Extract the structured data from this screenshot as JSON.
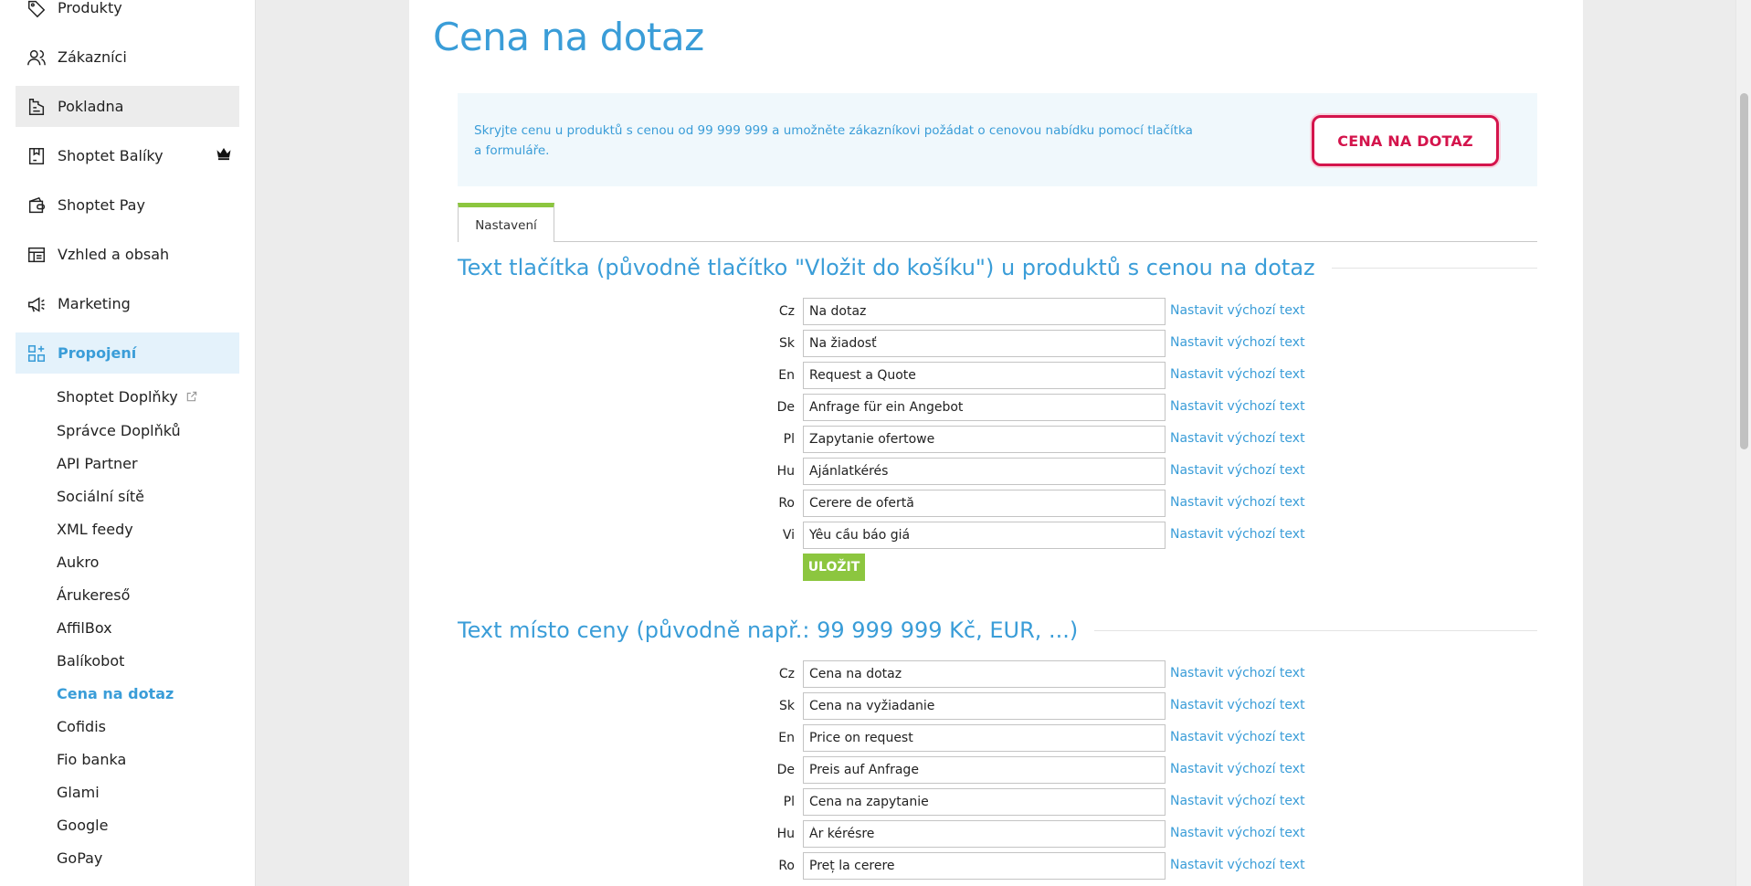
{
  "sidebar": {
    "nav": [
      {
        "label": "Produkty",
        "icon": "tag-icon"
      },
      {
        "label": "Zákazníci",
        "icon": "users-icon"
      },
      {
        "label": "Pokladna",
        "icon": "cash-register-icon"
      },
      {
        "label": "Shoptet Balíky",
        "icon": "package-icon"
      },
      {
        "label": "Shoptet Pay",
        "icon": "wallet-icon"
      },
      {
        "label": "Vzhled a obsah",
        "icon": "layout-icon"
      },
      {
        "label": "Marketing",
        "icon": "megaphone-icon"
      },
      {
        "label": "Propojení",
        "icon": "grid-plus-icon"
      }
    ],
    "sub_items": [
      {
        "label": "Shoptet Doplňky",
        "external": true
      },
      {
        "label": "Správce Doplňků"
      },
      {
        "label": "API Partner"
      },
      {
        "label": "Sociální sítě"
      },
      {
        "label": "XML feedy"
      },
      {
        "label": "Aukro"
      },
      {
        "label": "Árukereső"
      },
      {
        "label": "AffilBox"
      },
      {
        "label": "Balíkobot"
      },
      {
        "label": "Cena na dotaz",
        "active": true
      },
      {
        "label": "Cofidis"
      },
      {
        "label": "Fio banka"
      },
      {
        "label": "Glami"
      },
      {
        "label": "Google"
      },
      {
        "label": "GoPay"
      }
    ]
  },
  "page": {
    "title": "Cena na dotaz",
    "info_text": "Skryjte cenu u produktů s cenou od 99 999 999 a umožněte zákazníkovi požádat o cenovou nabídku pomocí tlačítka a formuláře.",
    "promo_button": "CENA NA DOTAZ",
    "tab": "Nastavení",
    "save_label": "ULOŽIT",
    "reset_label": "Nastavit výchozí text",
    "section1": {
      "heading": "Text tlačítka (původně tlačítko \"Vložit do košíku\") u produktů s cenou na dotaz",
      "rows": [
        {
          "lang": "Cz",
          "value": "Na dotaz"
        },
        {
          "lang": "Sk",
          "value": "Na žiadosť"
        },
        {
          "lang": "En",
          "value": "Request a Quote"
        },
        {
          "lang": "De",
          "value": "Anfrage für ein Angebot"
        },
        {
          "lang": "Pl",
          "value": "Zapytanie ofertowe"
        },
        {
          "lang": "Hu",
          "value": "Ajánlatkérés"
        },
        {
          "lang": "Ro",
          "value": "Cerere de ofertă"
        },
        {
          "lang": "Vi",
          "value": "Yêu cầu báo giá"
        }
      ]
    },
    "section2": {
      "heading": "Text místo ceny (původně např.: 99 999 999 Kč, EUR, ...)",
      "rows": [
        {
          "lang": "Cz",
          "value": "Cena na dotaz"
        },
        {
          "lang": "Sk",
          "value": "Cena na vyžiadanie"
        },
        {
          "lang": "En",
          "value": "Price on request"
        },
        {
          "lang": "De",
          "value": "Preis auf Anfrage"
        },
        {
          "lang": "Pl",
          "value": "Cena na zapytanie"
        },
        {
          "lang": "Hu",
          "value": "Ár kérésre"
        },
        {
          "lang": "Ro",
          "value": "Preț la cerere"
        }
      ]
    }
  },
  "colors": {
    "accent": "#3a9dd8",
    "brand_green": "#8cc63f",
    "promo_red": "#d4144c"
  }
}
